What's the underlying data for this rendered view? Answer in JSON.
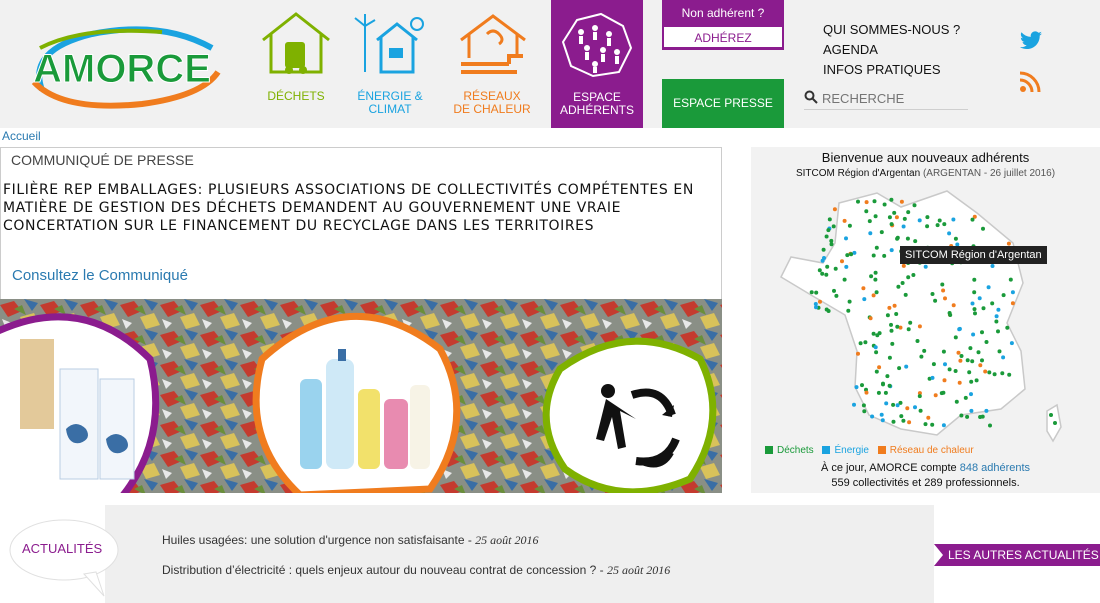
{
  "brand": {
    "name": "AMORCE",
    "purple": "#8b1c8e",
    "green": "#1a9a3a"
  },
  "nav": {
    "dechets": "Déchets",
    "energie": "Énergie & Climat",
    "reseaux_line1": "Réseaux",
    "reseaux_line2": "de chaleur",
    "espace_line1": "Espace",
    "espace_line2": "adhérents"
  },
  "adhesion": {
    "question": "Non adhérent ?",
    "button": "ADHÉREZ"
  },
  "espace_presse": "Espace presse",
  "toplinks": [
    "QUI SOMMES-NOUS ?",
    "AGENDA",
    "INFOS PRATIQUES"
  ],
  "search": {
    "placeholder": "RECHERCHE"
  },
  "icons": {
    "search": "search-icon",
    "twitter": "twitter-icon",
    "rss": "rss-icon"
  },
  "breadcrumb": "Accueil",
  "communique": {
    "kicker": "Communiqué de presse",
    "title": "Filière REP emballages: plusieurs associations de collectivités compétentes en matière de gestion des déchets demandent au gouvernement une vraie concertation sur le financement du recyclage dans les territoires",
    "link": "Consultez le Communiqué"
  },
  "map": {
    "title": "Bienvenue aux nouveaux adhérents",
    "subtitle_name": "SITCOM Région d'Argentan",
    "subtitle_detail": "(ARGENTAN - 26 juillet 2016)",
    "tooltip": "SITCOM Région d'Argentan",
    "legend": [
      {
        "label": "Déchets",
        "color": "#1a9a3a"
      },
      {
        "label": "Énergie",
        "color": "#1aa3e0"
      },
      {
        "label": "Réseau de chaleur",
        "color": "#f07c1e"
      }
    ],
    "count_prefix": "À ce jour, AMORCE compte",
    "count_link": "848 adhérents",
    "count_line2": "559 collectivités et 289 professionnels."
  },
  "actualites": {
    "label": "Actualités",
    "items": [
      {
        "title": "Huiles usagées: une solution d'urgence non satisfaisante - ",
        "date": "25 août 2016"
      },
      {
        "title": "Distribution d’électricité : quels enjeux autour du nouveau contrat de concession ? - ",
        "date": "25 août 2016"
      }
    ],
    "more": "Les autres actualités"
  }
}
